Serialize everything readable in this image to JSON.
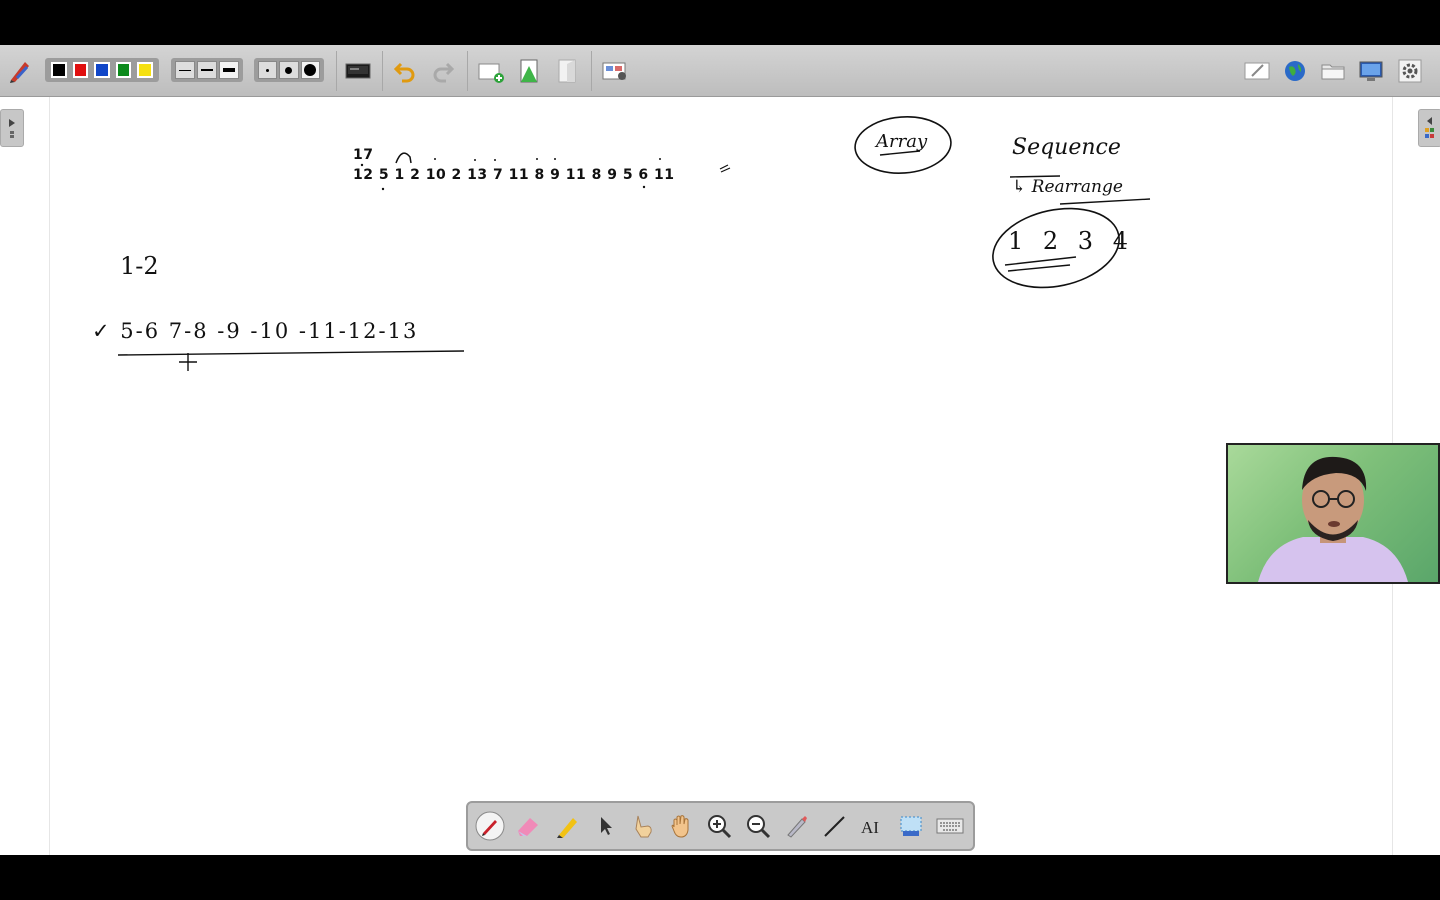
{
  "toolbar": {
    "colors": [
      "#000000",
      "#e01010",
      "#1046c8",
      "#0c8a1c",
      "#f5e010"
    ],
    "line_widths": [
      "thin",
      "medium",
      "thick"
    ],
    "dot_sizes": [
      "small",
      "medium",
      "large"
    ]
  },
  "canvas": {
    "sequence_top": "17",
    "sequence_bottom": "12 5 1 2 10 2 13 7 11 8 9 11 8 9 5 6 11",
    "note_range": "1-2",
    "note_chain": "✓ 5-6 7-8 -9 -10 -11-12-13",
    "note_array": "Array",
    "note_sequence": "Sequence",
    "note_rearrange": "↳ Rearrange",
    "note_digits": "1 2 3 4"
  },
  "floating_toolbar": {
    "tools": [
      "pen-icon",
      "eraser-icon",
      "highlighter-icon",
      "pointer-icon",
      "finger-pointer-icon",
      "hand-pan-icon",
      "zoom-in-icon",
      "zoom-out-icon",
      "magic-pen-icon",
      "line-icon",
      "text-icon",
      "screen-capture-icon",
      "keyboard-icon"
    ]
  }
}
